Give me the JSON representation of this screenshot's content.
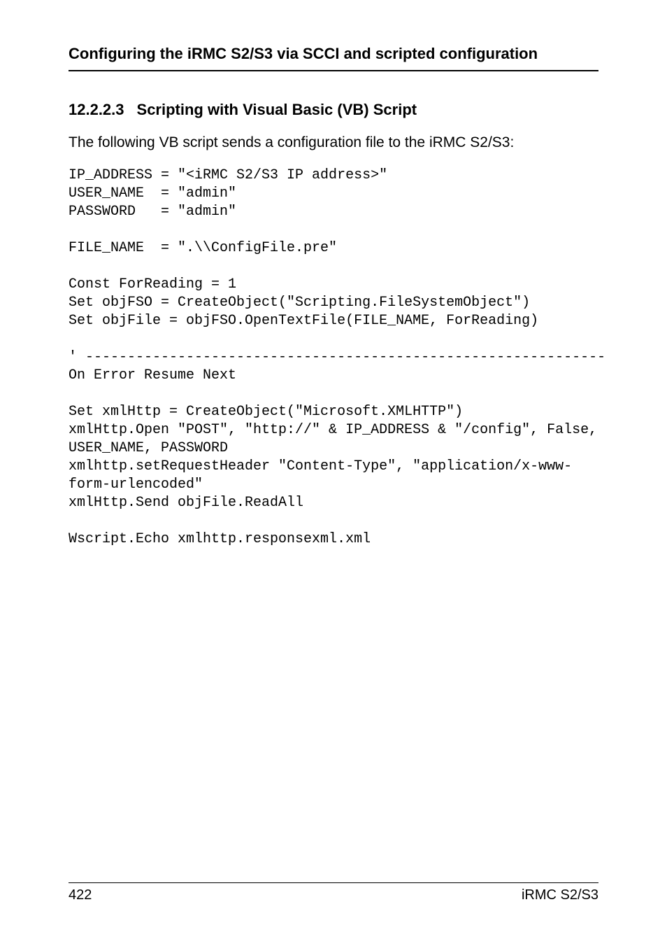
{
  "header": {
    "running_head": "Configuring the iRMC S2/S3 via SCCI and scripted configuration"
  },
  "section": {
    "number": "12.2.2.3",
    "title": "Scripting with Visual Basic (VB) Script"
  },
  "intro": "The following VB script sends a configuration file to the iRMC S2/S3:",
  "code": "IP_ADDRESS = \"<iRMC S2/S3 IP address>\"\nUSER_NAME  = \"admin\"\nPASSWORD   = \"admin\"\n\nFILE_NAME  = \".\\\\ConfigFile.pre\"\n\nConst ForReading = 1\nSet objFSO = CreateObject(\"Scripting.FileSystemObject\")\nSet objFile = objFSO.OpenTextFile(FILE_NAME, ForReading)\n\n' --------------------------------------------------------------\nOn Error Resume Next\n\nSet xmlHttp = CreateObject(\"Microsoft.XMLHTTP\")\nxmlHttp.Open \"POST\", \"http://\" & IP_ADDRESS & \"/config\", False, \nUSER_NAME, PASSWORD\nxmlhttp.setRequestHeader \"Content-Type\", \"application/x-www-\nform-urlencoded\"\nxmlHttp.Send objFile.ReadAll\n\nWscript.Echo xmlhttp.responsexml.xml",
  "footer": {
    "page_number": "422",
    "doc_label": "iRMC S2/S3"
  }
}
